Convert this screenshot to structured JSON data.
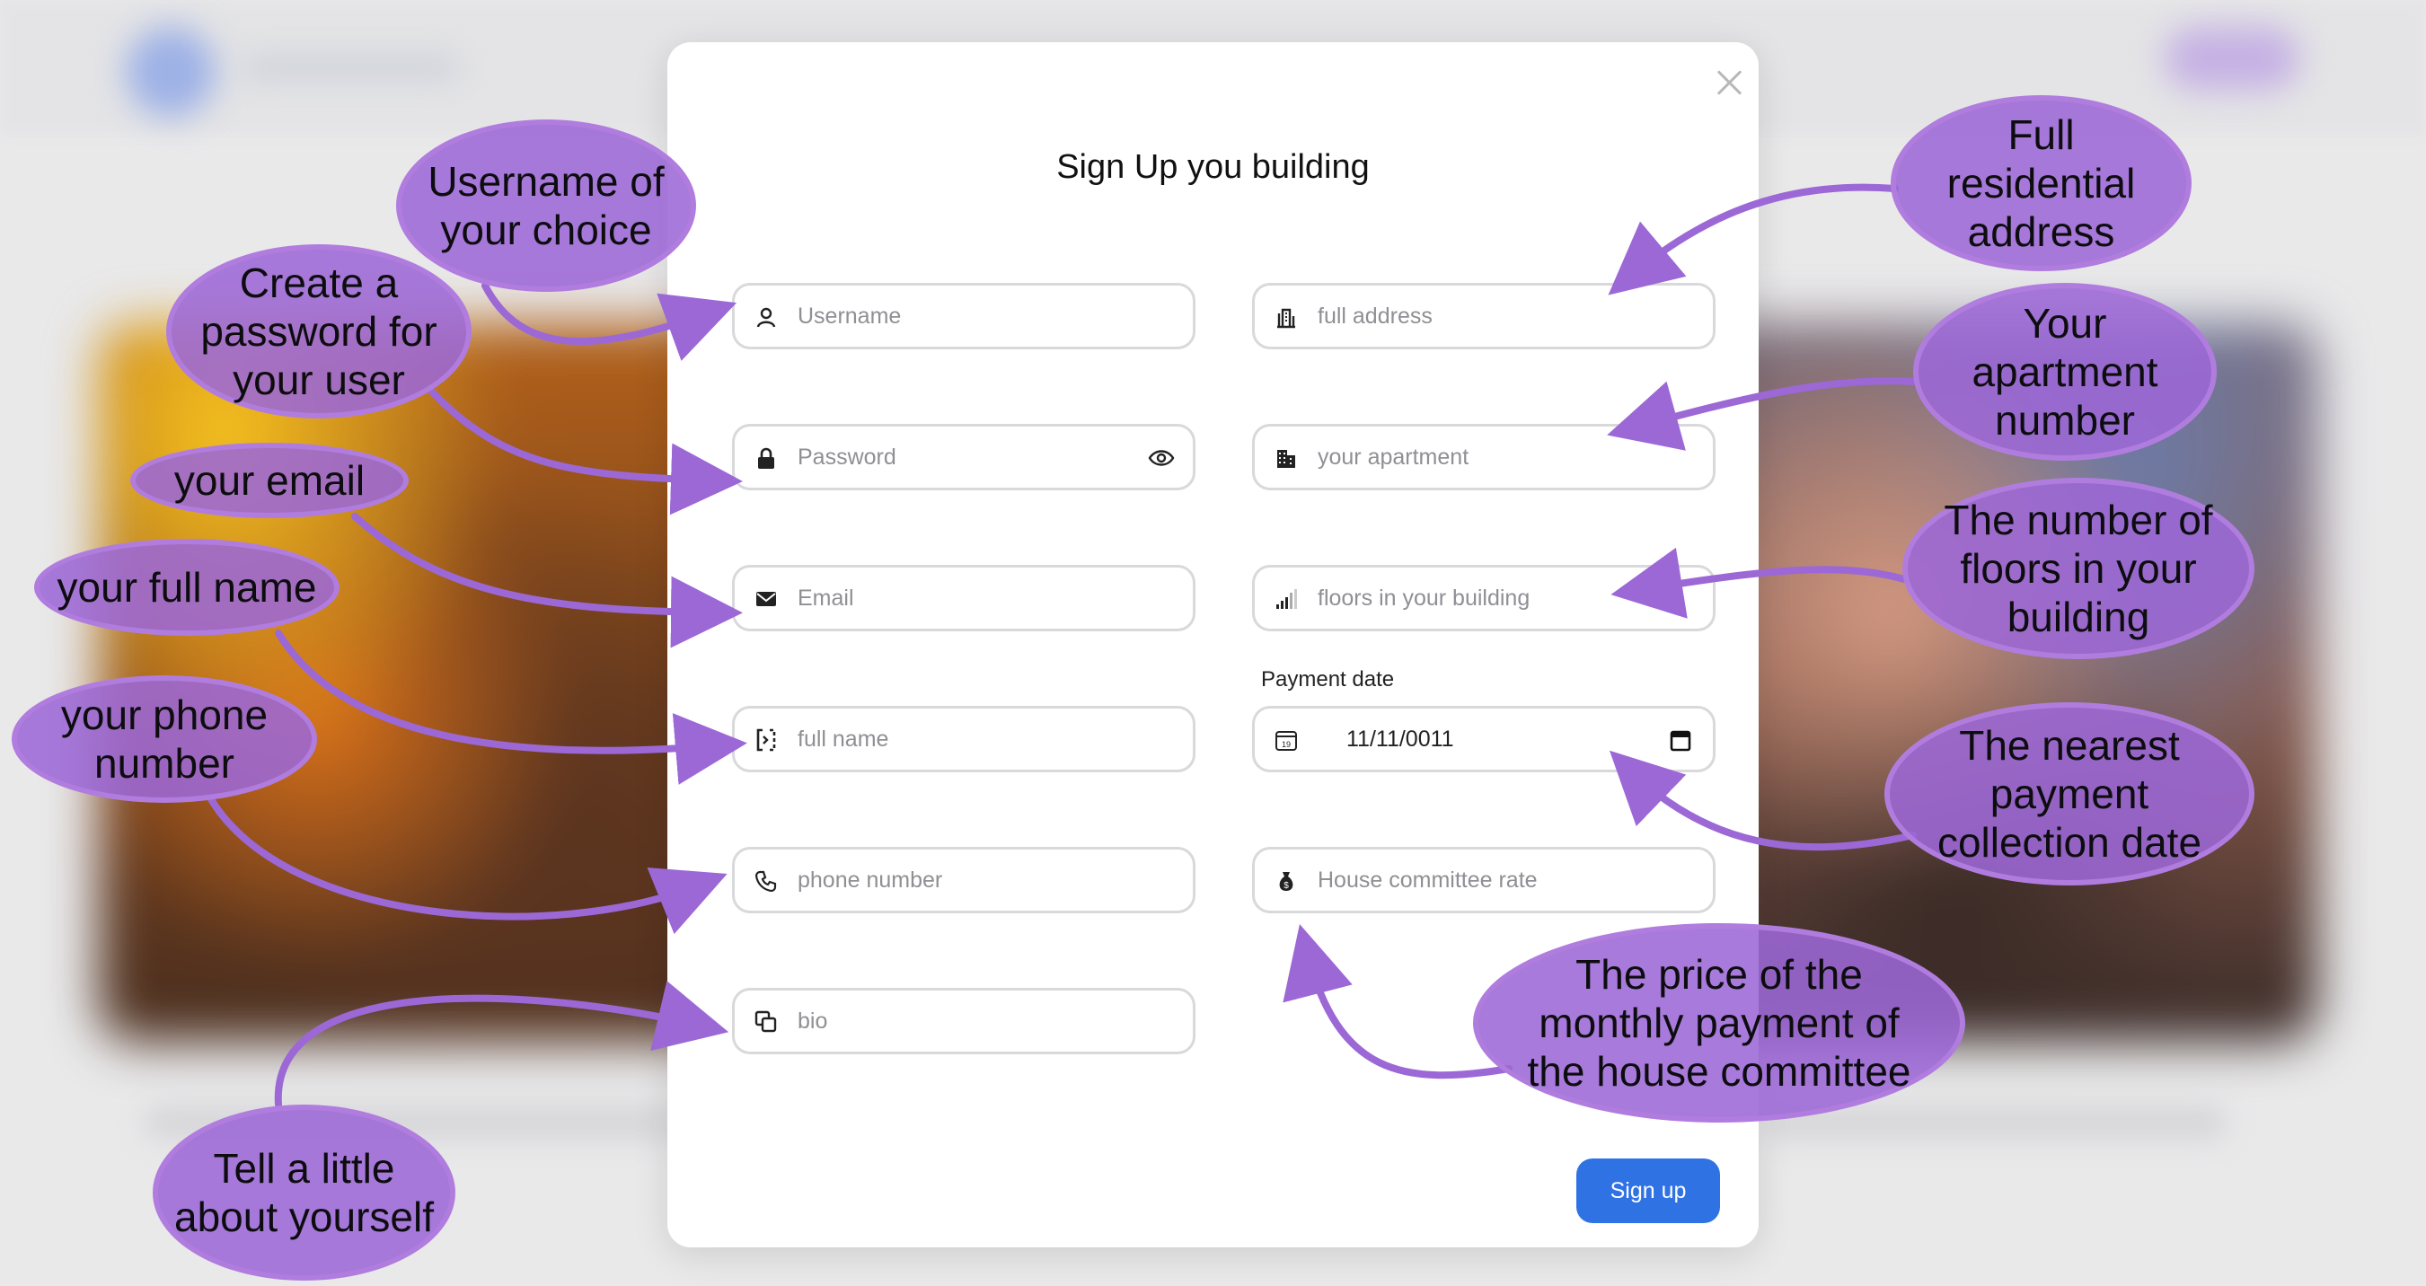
{
  "modal": {
    "title": "Sign Up you building",
    "close_icon": "close-icon",
    "left_fields": [
      {
        "name": "username",
        "placeholder": "Username",
        "icon": "user-icon"
      },
      {
        "name": "password",
        "placeholder": "Password",
        "icon": "lock-icon",
        "trailing_icon": "eye-icon"
      },
      {
        "name": "email",
        "placeholder": "Email",
        "icon": "envelope-icon"
      },
      {
        "name": "full-name",
        "placeholder": "full name",
        "icon": "id-bracket-icon"
      },
      {
        "name": "phone-number",
        "placeholder": "phone number",
        "icon": "phone-icon"
      },
      {
        "name": "bio",
        "placeholder": "bio",
        "icon": "copy-squares-icon"
      }
    ],
    "right_fields": [
      {
        "name": "full-address",
        "placeholder": "full address",
        "icon": "bank-building-icon"
      },
      {
        "name": "apartment",
        "placeholder": "your apartment",
        "icon": "apartment-building-icon"
      },
      {
        "name": "floors",
        "placeholder": "floors in your building",
        "icon": "signal-bars-icon"
      },
      {
        "name": "payment-date",
        "label": "Payment date",
        "value": "11/11/0011",
        "icon": "calendar-icon",
        "trailing_icon": "calendar-picker-icon"
      },
      {
        "name": "house-committee-rate",
        "placeholder": "House committee rate",
        "icon": "money-bag-icon"
      }
    ],
    "submit_label": "Sign up",
    "accent_color": "#2f72e4"
  },
  "annotations": [
    {
      "name": "username",
      "text": "Username of\nyour choice"
    },
    {
      "name": "password",
      "text": "Create a\npassword for\nyour user"
    },
    {
      "name": "email",
      "text": "your email"
    },
    {
      "name": "full-name",
      "text": "your full name"
    },
    {
      "name": "phone",
      "text": "your phone\nnumber"
    },
    {
      "name": "bio",
      "text": "Tell a little\nabout yourself"
    },
    {
      "name": "address",
      "text": "Full\nresidential\naddress"
    },
    {
      "name": "apartment",
      "text": "Your\napartment\nnumber"
    },
    {
      "name": "floors",
      "text": "The number of\nfloors in your\nbuilding"
    },
    {
      "name": "payment",
      "text": "The nearest\npayment\ncollection date"
    },
    {
      "name": "committee",
      "text": "The price of the\nmonthly payment of\nthe house committee"
    }
  ],
  "annotation_color": "#9c68d6"
}
